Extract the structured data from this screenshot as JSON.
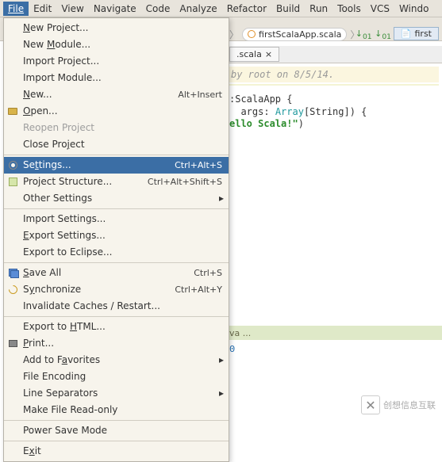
{
  "menubar": {
    "file": "File",
    "edit": "Edit",
    "view": "View",
    "navigate": "Navigate",
    "code": "Code",
    "analyze": "Analyze",
    "refactor": "Refactor",
    "build": "Build",
    "run": "Run",
    "tools": "Tools",
    "vcs": "VCS",
    "window": "Windo"
  },
  "breadcrumb": {
    "file": "firstScalaApp.scala",
    "small_tab": "first"
  },
  "tab": {
    "label": ".scala",
    "close": "×"
  },
  "editor": {
    "comment": "by root on 8/5/14.",
    "l1_a": ":ScalaApp {",
    "l2_a": "args: ",
    "l2_type": "Array",
    "l2_b": "[String]) {",
    "l3_str": "ello Scala!\"",
    "l3_b": ")"
  },
  "run": {
    "label": "va ..."
  },
  "console": {
    "line1": "0"
  },
  "file_menu": {
    "new_project": "New Project...",
    "new_module": "New Module...",
    "import_project": "Import Project...",
    "import_module": "Import Module...",
    "new": "New...",
    "new_sc": "Alt+Insert",
    "open": "Open...",
    "reopen": "Reopen Project",
    "close_project": "Close Project",
    "settings": "Settings...",
    "settings_sc": "Ctrl+Alt+S",
    "project_structure": "Project Structure...",
    "project_structure_sc": "Ctrl+Alt+Shift+S",
    "other_settings": "Other Settings",
    "import_settings": "Import Settings...",
    "export_settings": "Export Settings...",
    "export_eclipse": "Export to Eclipse...",
    "save_all": "Save All",
    "save_all_sc": "Ctrl+S",
    "synchronize": "Synchronize",
    "synchronize_sc": "Ctrl+Alt+Y",
    "invalidate": "Invalidate Caches / Restart...",
    "export_html": "Export to HTML...",
    "print": "Print...",
    "add_fav": "Add to Favorites",
    "file_encoding": "File Encoding",
    "line_sep": "Line Separators",
    "make_ro": "Make File Read-only",
    "power_save": "Power Save Mode",
    "exit": "Exit"
  },
  "watermark": "创想信息互联"
}
